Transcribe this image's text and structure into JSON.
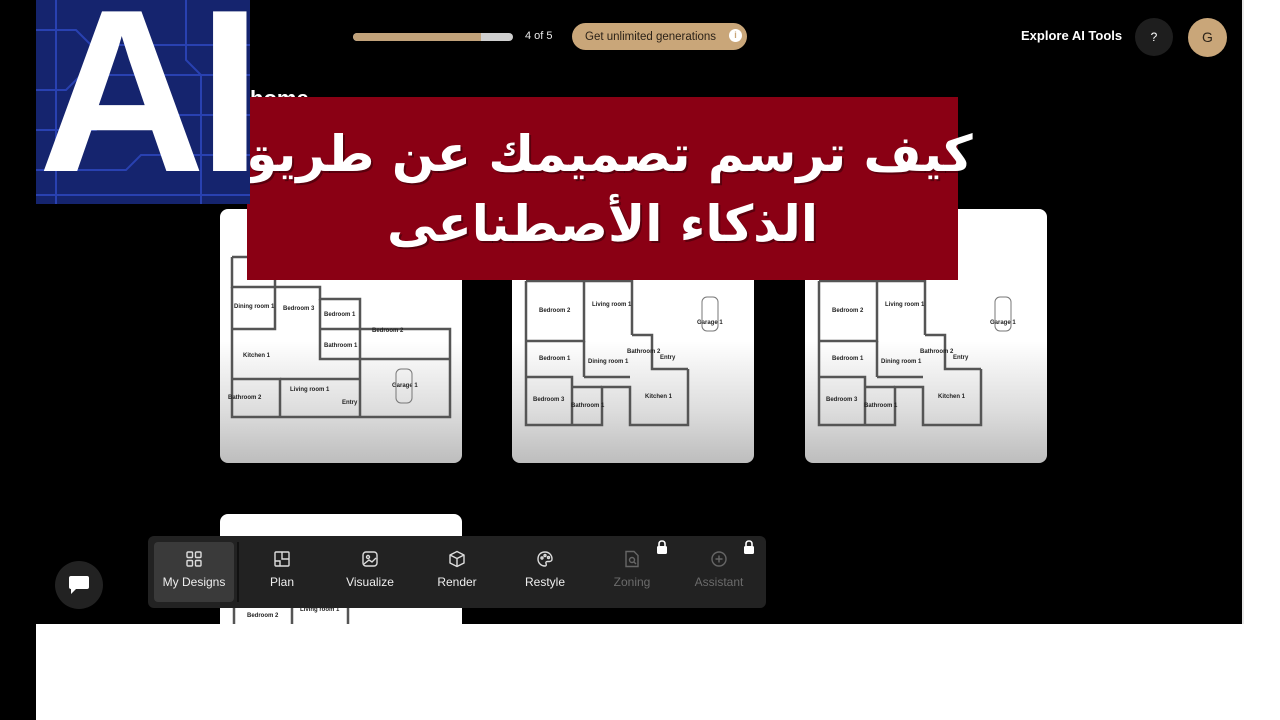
{
  "header": {
    "progress_text": "4 of 5",
    "progress_fraction": 0.8,
    "upgrade_label": "Get unlimited generations",
    "upgrade_info": "i",
    "explore_label": "Explore AI Tools",
    "help_label": "?",
    "avatar_initial": "G"
  },
  "overlay": {
    "logo_text": "AI",
    "heading_fragment": "home",
    "banner_line1": "كيف ترسم تصميمك عن طريق",
    "banner_line2": "الذكاء الأصطناعى"
  },
  "cards": [
    {
      "rooms": [
        "Dining room 1",
        "Bedroom 3",
        "Bedroom 1",
        "Bedroom 2",
        "Bathroom 1",
        "Kitchen 1",
        "Living room 1",
        "Garage 1",
        "Bathroom 2",
        "Entry"
      ]
    },
    {
      "rooms": [
        "Bedroom 2",
        "Living room 1",
        "Garage 1",
        "Bathroom 2",
        "Entry",
        "Bedroom 1",
        "Dining room 1",
        "Bedroom 3",
        "Bathroom 1",
        "Kitchen 1"
      ]
    },
    {
      "rooms": [
        "Bedroom 2",
        "Living room 1",
        "Garage 1",
        "Bathroom 2",
        "Entry",
        "Bedroom 1",
        "Dining room 1",
        "Bedroom 3",
        "Bathroom 1",
        "Kitchen 1"
      ]
    },
    {
      "rooms": [
        "Bedroom 2",
        "Living room 1"
      ]
    }
  ],
  "toolbar": {
    "items": [
      {
        "label": "My Designs",
        "icon": "grid-icon",
        "active": true,
        "locked": false
      },
      {
        "label": "Plan",
        "icon": "floorplan-icon",
        "active": false,
        "locked": false
      },
      {
        "label": "Visualize",
        "icon": "image-icon",
        "active": false,
        "locked": false
      },
      {
        "label": "Render",
        "icon": "cube-icon",
        "active": false,
        "locked": false
      },
      {
        "label": "Restyle",
        "icon": "palette-icon",
        "active": false,
        "locked": false
      },
      {
        "label": "Zoning",
        "icon": "zoning-doc-icon",
        "active": false,
        "locked": true
      },
      {
        "label": "Assistant",
        "icon": "assistant-plus-icon",
        "active": false,
        "locked": true
      }
    ]
  },
  "colors": {
    "accent": "#c9a679",
    "banner": "#8a0014",
    "logo_bg": "#15246e"
  }
}
